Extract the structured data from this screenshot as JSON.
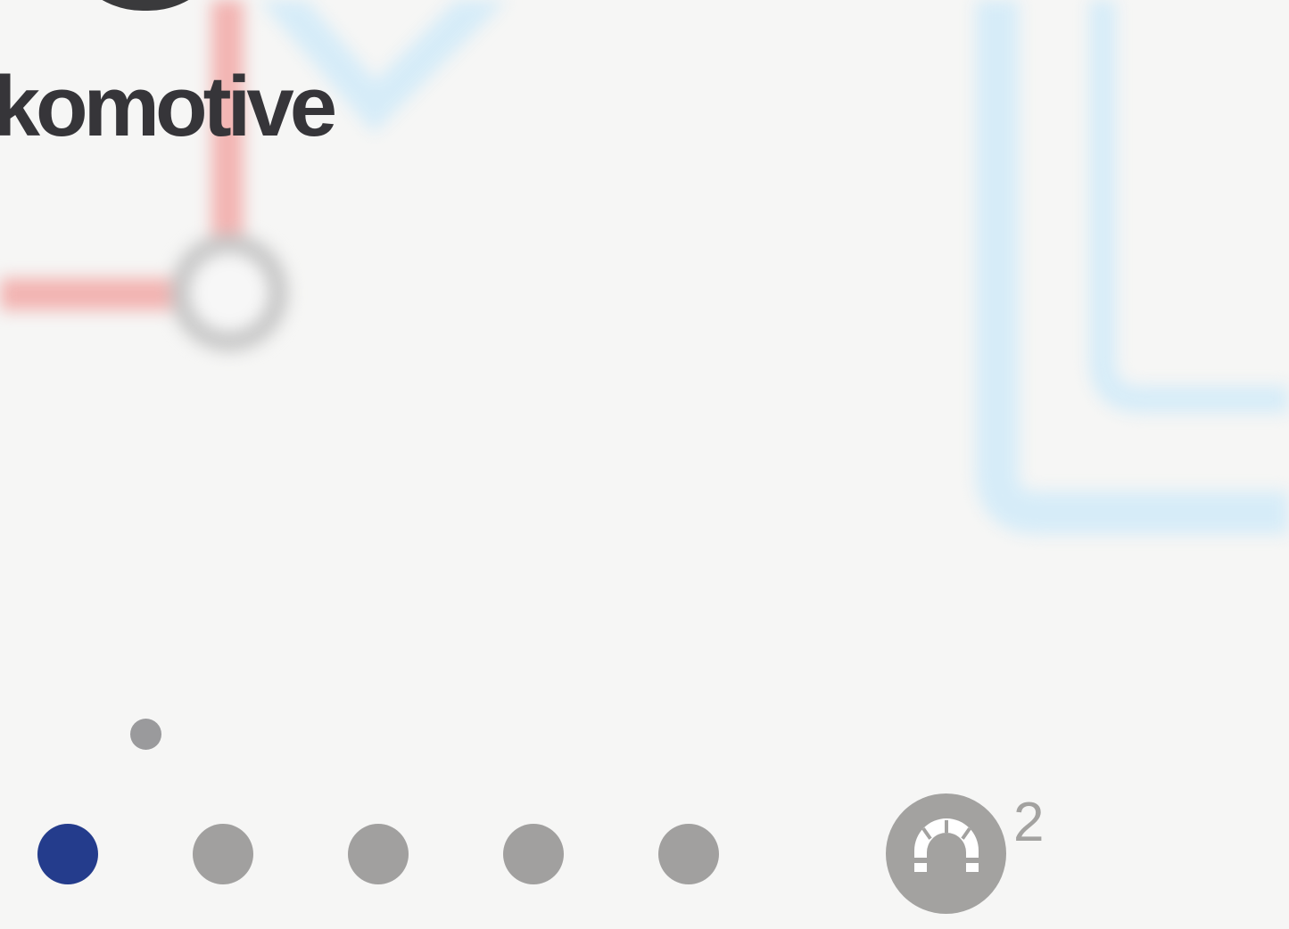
{
  "station": {
    "name": "okomotive"
  },
  "map": {
    "red_line_color": "#f2b3b1",
    "blue_line_color": "#d6ecf8",
    "station_ring_color": "#c7c7c7"
  },
  "line_selector": {
    "items": [
      {
        "color": "#243c8c",
        "active": true
      },
      {
        "color": "#a1a09f",
        "active": false
      },
      {
        "color": "#a1a09f",
        "active": false
      },
      {
        "color": "#a1a09f",
        "active": false
      },
      {
        "color": "#a1a09f",
        "active": false
      }
    ],
    "indicator_color": "#9a9a9c"
  },
  "tunnel": {
    "icon": "tunnel-icon",
    "count": "2",
    "color": "#a3a2a0"
  }
}
